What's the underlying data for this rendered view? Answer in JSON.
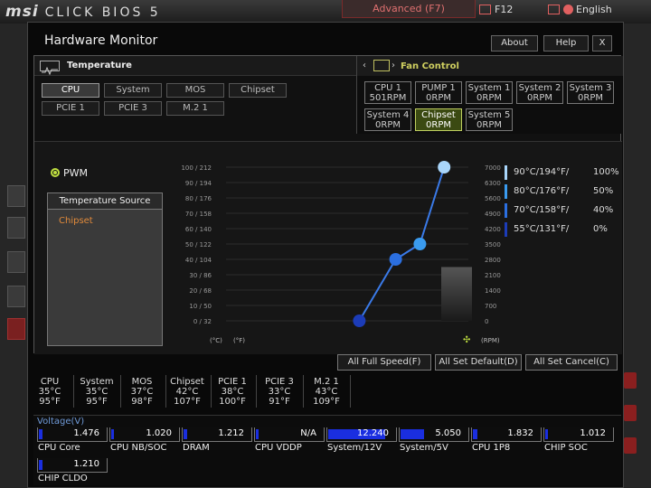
{
  "app": {
    "logo_brand": "msi",
    "logo_product": "CLICK BIOS 5",
    "mode_tab": "Advanced (F7)",
    "f12": "F12",
    "language": "English"
  },
  "window": {
    "title": "Hardware Monitor",
    "about": "About",
    "help": "Help",
    "close": "X"
  },
  "temperature": {
    "title": "Temperature",
    "sensors": [
      {
        "label": "CPU",
        "selected": true
      },
      {
        "label": "System",
        "selected": false
      },
      {
        "label": "MOS",
        "selected": false
      },
      {
        "label": "Chipset",
        "selected": false
      },
      {
        "label": "PCIE 1",
        "selected": false
      },
      {
        "label": "PCIE 3",
        "selected": false
      },
      {
        "label": "M.2 1",
        "selected": false
      }
    ]
  },
  "fan_control": {
    "title": "Fan Control",
    "prev": "‹",
    "next": "›",
    "fans": [
      {
        "name": "CPU 1",
        "rpm": "501RPM",
        "selected": false
      },
      {
        "name": "PUMP 1",
        "rpm": "0RPM",
        "selected": false
      },
      {
        "name": "System 1",
        "rpm": "0RPM",
        "selected": false
      },
      {
        "name": "System 2",
        "rpm": "0RPM",
        "selected": false
      },
      {
        "name": "System 3",
        "rpm": "0RPM",
        "selected": false
      },
      {
        "name": "System 4",
        "rpm": "0RPM",
        "selected": false
      },
      {
        "name": "Chipset",
        "rpm": "0RPM",
        "selected": true
      },
      {
        "name": "System 5",
        "rpm": "0RPM",
        "selected": false
      }
    ]
  },
  "mode": {
    "pwm_label": "PWM"
  },
  "temp_source": {
    "header": "Temperature Source",
    "value": "Chipset"
  },
  "chart_data": {
    "type": "line",
    "left_ticks": [
      "100 / 212",
      "90 / 194",
      "80 / 176",
      "70 / 158",
      "60 / 140",
      "50 / 122",
      "40 / 104",
      "30 /  86",
      "20 /  68",
      "10 /  50",
      "0 /  32"
    ],
    "right_ticks": [
      "7000",
      "6300",
      "5600",
      "4900",
      "4200",
      "3500",
      "2800",
      "2100",
      "1400",
      "700",
      "0"
    ],
    "x_units": [
      "(°C)",
      "(°F)"
    ],
    "rpm_unit": "(RPM)",
    "ylim_temp_c": [
      0,
      100
    ],
    "ylim_rpm": [
      0,
      7000
    ],
    "x": [
      55,
      70,
      80,
      90
    ],
    "y": [
      0,
      40,
      50,
      100
    ],
    "point_colors": [
      "#1c3cb8",
      "#2b6fe0",
      "#3a9bef",
      "#a9d6fb"
    ],
    "current_rpm": 0,
    "legend": [
      {
        "temp": "90°C/194°F/",
        "pct": "100%",
        "color": "#a9d6fb"
      },
      {
        "temp": "80°C/176°F/",
        "pct": "50%",
        "color": "#3a9bef"
      },
      {
        "temp": "70°C/158°F/",
        "pct": "40%",
        "color": "#2b6fe0"
      },
      {
        "temp": "55°C/131°F/",
        "pct": "0%",
        "color": "#1c3cb8"
      }
    ]
  },
  "actions": {
    "full_speed": "All Full Speed(F)",
    "set_default": "All Set Default(D)",
    "set_cancel": "All Set Cancel(C)"
  },
  "temps": [
    {
      "name": "CPU",
      "c": "35°C",
      "f": "95°F"
    },
    {
      "name": "System",
      "c": "35°C",
      "f": "95°F"
    },
    {
      "name": "MOS",
      "c": "37°C",
      "f": "98°F"
    },
    {
      "name": "Chipset",
      "c": "42°C",
      "f": "107°F"
    },
    {
      "name": "PCIE 1",
      "c": "38°C",
      "f": "100°F"
    },
    {
      "name": "PCIE 3",
      "c": "33°C",
      "f": "91°F"
    },
    {
      "name": "M.2 1",
      "c": "43°C",
      "f": "109°F"
    }
  ],
  "voltage": {
    "title": "Voltage(V)",
    "items": [
      {
        "label": "CPU Core",
        "value": "1.476",
        "fill": 0.06
      },
      {
        "label": "CPU NB/SOC",
        "value": "1.020",
        "fill": 0.04
      },
      {
        "label": "DRAM",
        "value": "1.212",
        "fill": 0.05
      },
      {
        "label": "CPU VDDP",
        "value": "N/A",
        "fill": 0
      },
      {
        "label": "System/12V",
        "value": "12.240",
        "fill": 0.88
      },
      {
        "label": "System/5V",
        "value": "5.050",
        "fill": 0.36
      },
      {
        "label": "CPU 1P8",
        "value": "1.832",
        "fill": 0.07
      },
      {
        "label": "CHIP SOC",
        "value": "1.012",
        "fill": 0.04
      },
      {
        "label": "CHIP CLDO",
        "value": "1.210",
        "fill": 0.05
      }
    ]
  }
}
